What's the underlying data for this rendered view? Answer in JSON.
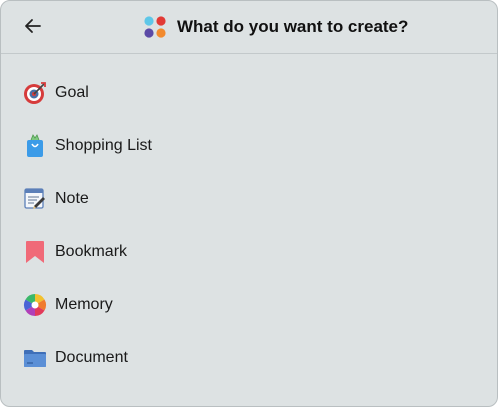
{
  "header": {
    "back_icon": "arrow-left-icon",
    "app_icon": "colored-dots-icon",
    "title": "What do you want to create?"
  },
  "items": [
    {
      "label": "Goal",
      "icon": "target-dart-icon"
    },
    {
      "label": "Shopping List",
      "icon": "shopping-bag-icon"
    },
    {
      "label": "Note",
      "icon": "note-pencil-icon"
    },
    {
      "label": "Bookmark",
      "icon": "bookmark-icon"
    },
    {
      "label": "Memory",
      "icon": "color-wheel-icon"
    },
    {
      "label": "Document",
      "icon": "folder-icon"
    }
  ],
  "colors": {
    "background": "#dde2e3",
    "divider": "#c3c9cb"
  }
}
